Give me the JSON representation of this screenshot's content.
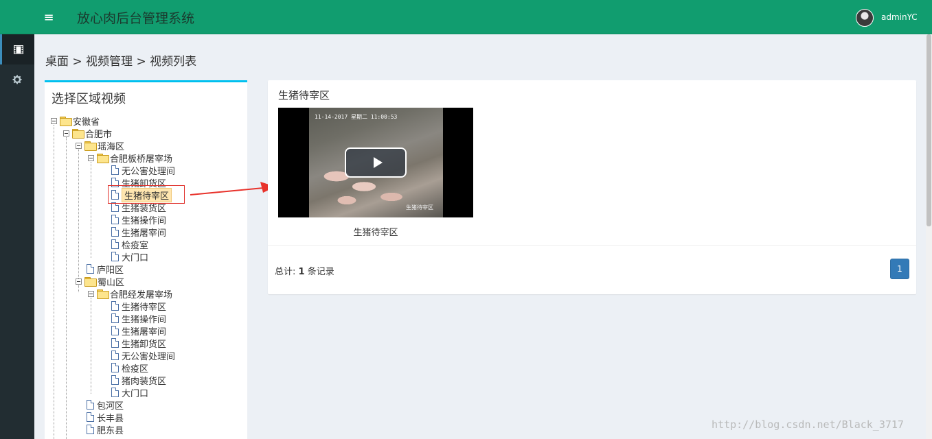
{
  "header": {
    "title": "放心肉后台管理系统",
    "menu_icon": "≡",
    "username": "adminYC"
  },
  "sidebar": {
    "items": [
      {
        "icon": "film-icon",
        "active": true
      },
      {
        "icon": "gear-icon",
        "active": false
      }
    ]
  },
  "breadcrumb": "桌面 > 视频管理 > 视频列表",
  "tree": {
    "title": "选择区域视频",
    "nodes": {
      "n0": "安徽省",
      "n1": "合肥市",
      "n2": "瑶海区",
      "n3": "合肥板桥屠宰场",
      "n4": "无公害处理间",
      "n5": "生猪卸货区",
      "n6": "生猪待宰区",
      "n7": "生猪装货区",
      "n8": "生猪操作间",
      "n9": "生猪屠宰间",
      "n10": "检疫室",
      "n11": "大门口",
      "n12": "庐阳区",
      "n13": "蜀山区",
      "n14": "合肥经发屠宰场",
      "n15": "生猪待宰区",
      "n16": "生猪操作间",
      "n17": "生猪屠宰间",
      "n18": "生猪卸货区",
      "n19": "无公害处理间",
      "n20": "检疫区",
      "n21": "猪肉装货区",
      "n22": "大门口",
      "n23": "包河区",
      "n24": "长丰县",
      "n25": "肥东县"
    },
    "selected": "n6"
  },
  "content": {
    "area_title": "生猪待宰区",
    "video": {
      "timestamp": "11-14-2017 星期二 11:00:53",
      "overlay": "生猪待宰区",
      "caption": "生猪待宰区"
    },
    "total_label": "总计:",
    "total_count": "1",
    "total_suffix": "条记录",
    "page": "1"
  },
  "watermark": "http://blog.csdn.net/Black_3717",
  "colors": {
    "header_bg": "#119d6f",
    "sidebar_bg": "#222d32",
    "panel_accent": "#00c0ef",
    "page_button": "#337ab7"
  }
}
